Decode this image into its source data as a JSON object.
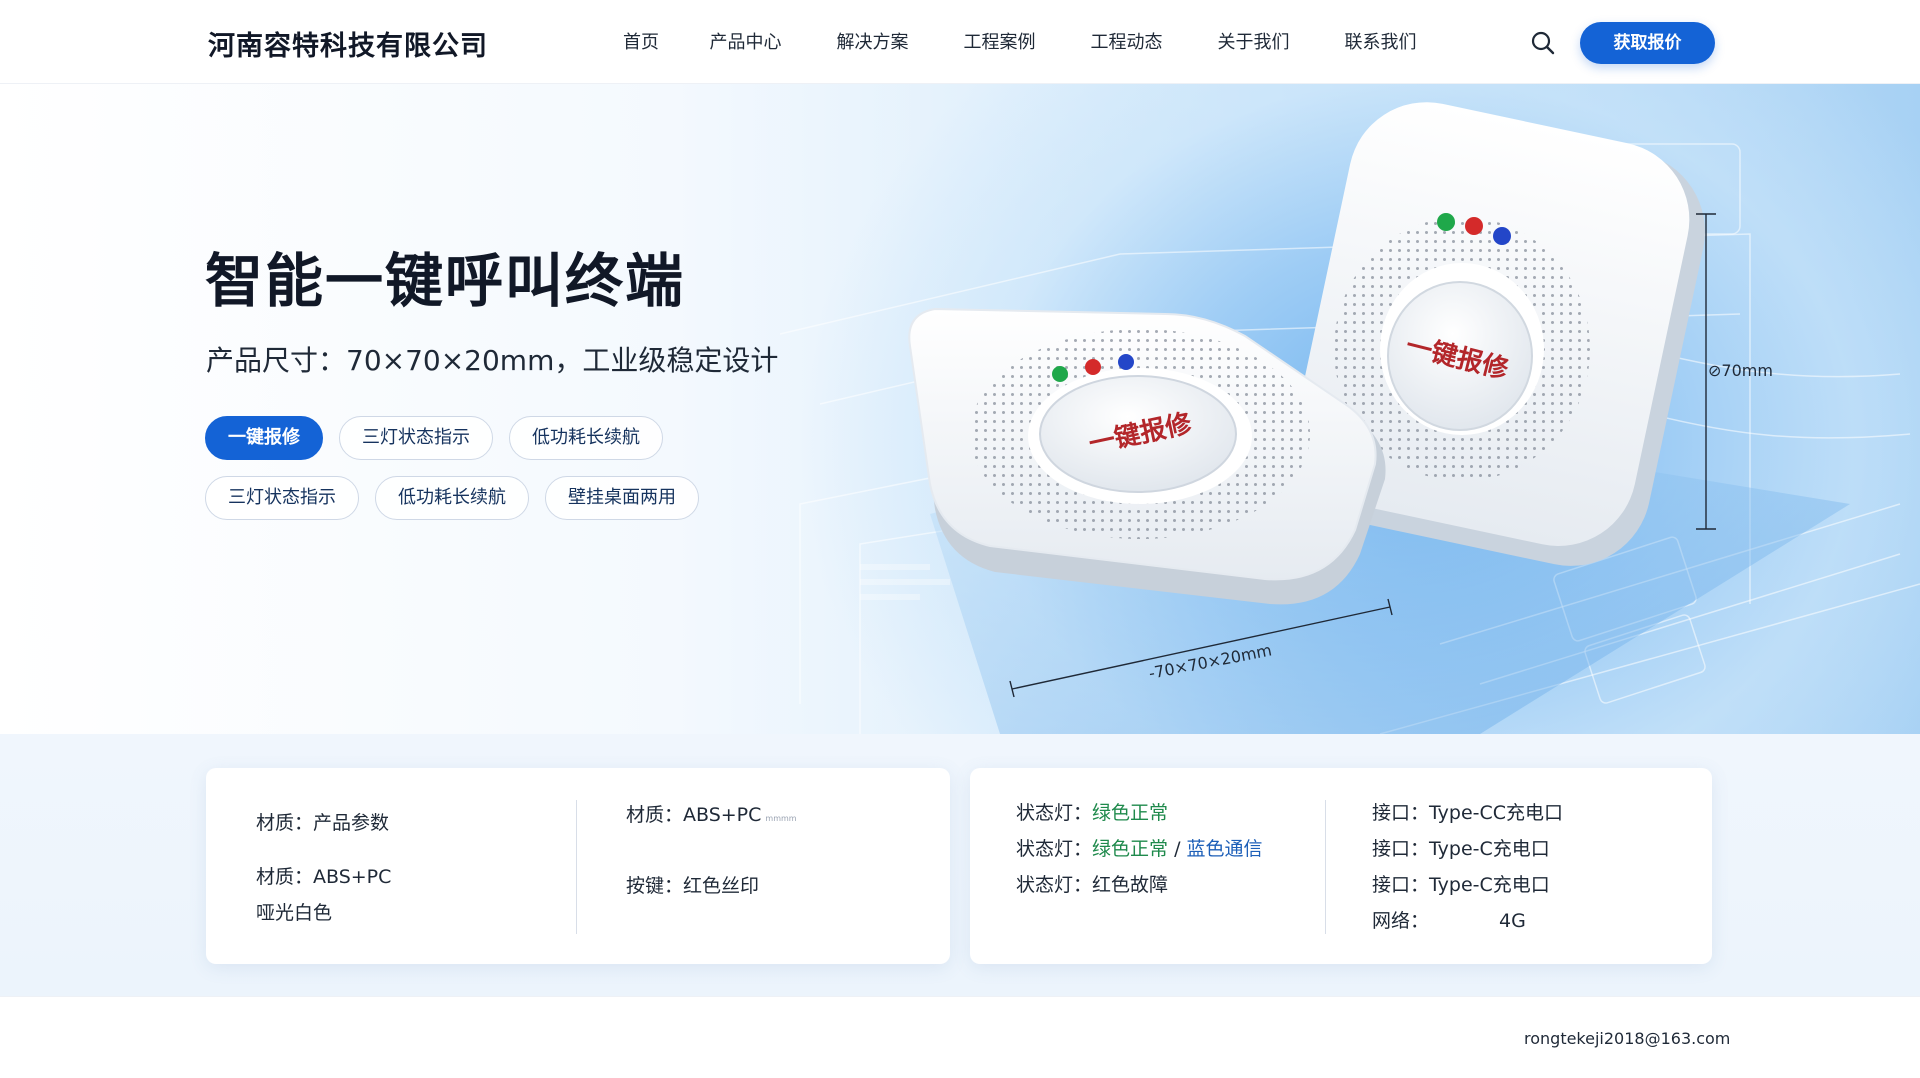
{
  "header": {
    "company_name": "河南容特科技有限公司",
    "nav": [
      "首页",
      "产品中心",
      "解决方案",
      "工程案例",
      "工程动态",
      "关于我们",
      "联系我们"
    ],
    "search_icon": "search-icon",
    "cta_label": "获取报价"
  },
  "hero": {
    "title": "智能一键呼叫终端",
    "subtitle": "产品尺寸：70×70×20mm，工业级稳定设计",
    "tags_row1": [
      "一键报修",
      "三灯状态指示",
      "低功耗长续航"
    ],
    "tags_row2": [
      "三灯状态指示",
      "低功耗长续航",
      "壁挂桌面两用"
    ],
    "device_button_text": "一键报修",
    "dimension_label_bottom": "-70×70×20mm",
    "dimension_label_side": "⊘70mm",
    "led_colors": [
      "#1fa84a",
      "#d42a2a",
      "#2346c8"
    ]
  },
  "specs": {
    "card1": {
      "col1": [
        "材质：产品参数",
        "材质：ABS+PC",
        "哑光白色"
      ],
      "col2_line1": "材质：ABS+PC",
      "col2_line1_small": "mmmm",
      "col2_line2": "按键：红色丝印"
    },
    "card2": {
      "status1_label": "状态灯：",
      "status1_value": "绿色正常",
      "status2_label": "状态灯：",
      "status2_green": "绿色正常",
      "status2_sep": " / ",
      "status2_blue": "蓝色通信",
      "status3_label": "状态灯：",
      "status3_value": "红色故障",
      "iface1": "接口：Type-CC充电口",
      "iface2": "接口：Type-C充电口",
      "iface3": "接口：Type-C充电口",
      "net_label": "网络：",
      "net_value": "4G"
    }
  },
  "footer": {
    "email": "rongtekeji2018@163.com"
  },
  "colors": {
    "accent": "#1463d6",
    "status_green": "#1f8a4c",
    "status_blue": "#1d5fb8"
  }
}
